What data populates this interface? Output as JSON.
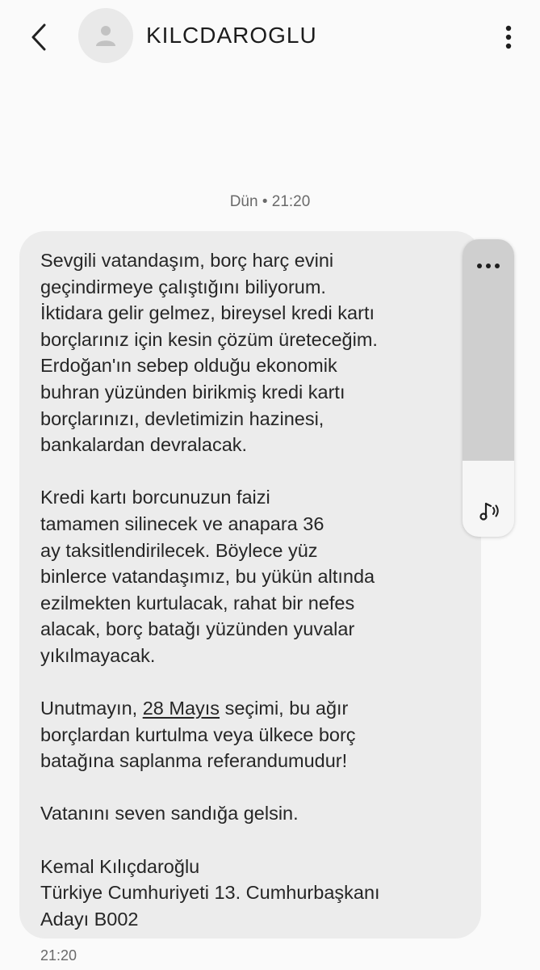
{
  "header": {
    "contact_name": "KILCDAROGLU",
    "icons": {
      "back": "chevron-left-icon",
      "avatar": "person-icon",
      "menu": "more-vertical-icon"
    }
  },
  "conversation": {
    "date_separator": "Dün • 21:20",
    "message": {
      "paragraphs": [
        "Sevgili vatandaşım, borç harç evini\ngeçindirmeye çalıştığını biliyorum.\nİktidara gelir gelmez, bireysel kredi kartı\nborçlarınız için kesin çözüm üreteceğim.\nErdoğan'ın sebep olduğu ekonomik\nbuhran yüzünden birikmiş kredi kartı\nborçlarınızı, devletimizin hazinesi,\nbankalardan devralacak.",
        "Kredi kartı borcunuzun faizi\ntamamen silinecek ve anapara 36\nay taksitlendirilecek. Böylece yüz\nbinlerce vatandaşımız, bu yükün altında\nezilmekten kurtulacak, rahat bir nefes\nalacak, borç batağı yüzünden yuvalar\nyıkılmayacak."
      ],
      "p3_before": "Unutmayın, ",
      "p3_link": "28 Mayıs",
      "p3_after": " seçimi, bu ağır\nborçlardan kurtulma veya ülkece borç\nbatağına saplanma referandumudur!",
      "p4": "Vatanını seven sandığa gelsin.",
      "p5": "Kemal Kılıçdaroğlu\nTürkiye Cumhuriyeti 13. Cumhurbaşkanı\nAdayı B002",
      "time": "21:20"
    },
    "side_actions": {
      "more": "more-horizontal-icon",
      "tts": "text-to-speech-icon"
    }
  },
  "colors": {
    "background": "#fafafa",
    "bubble": "#ececec",
    "side_top": "#cfcfcf",
    "text": "#262626",
    "muted": "#6a6a6a"
  }
}
